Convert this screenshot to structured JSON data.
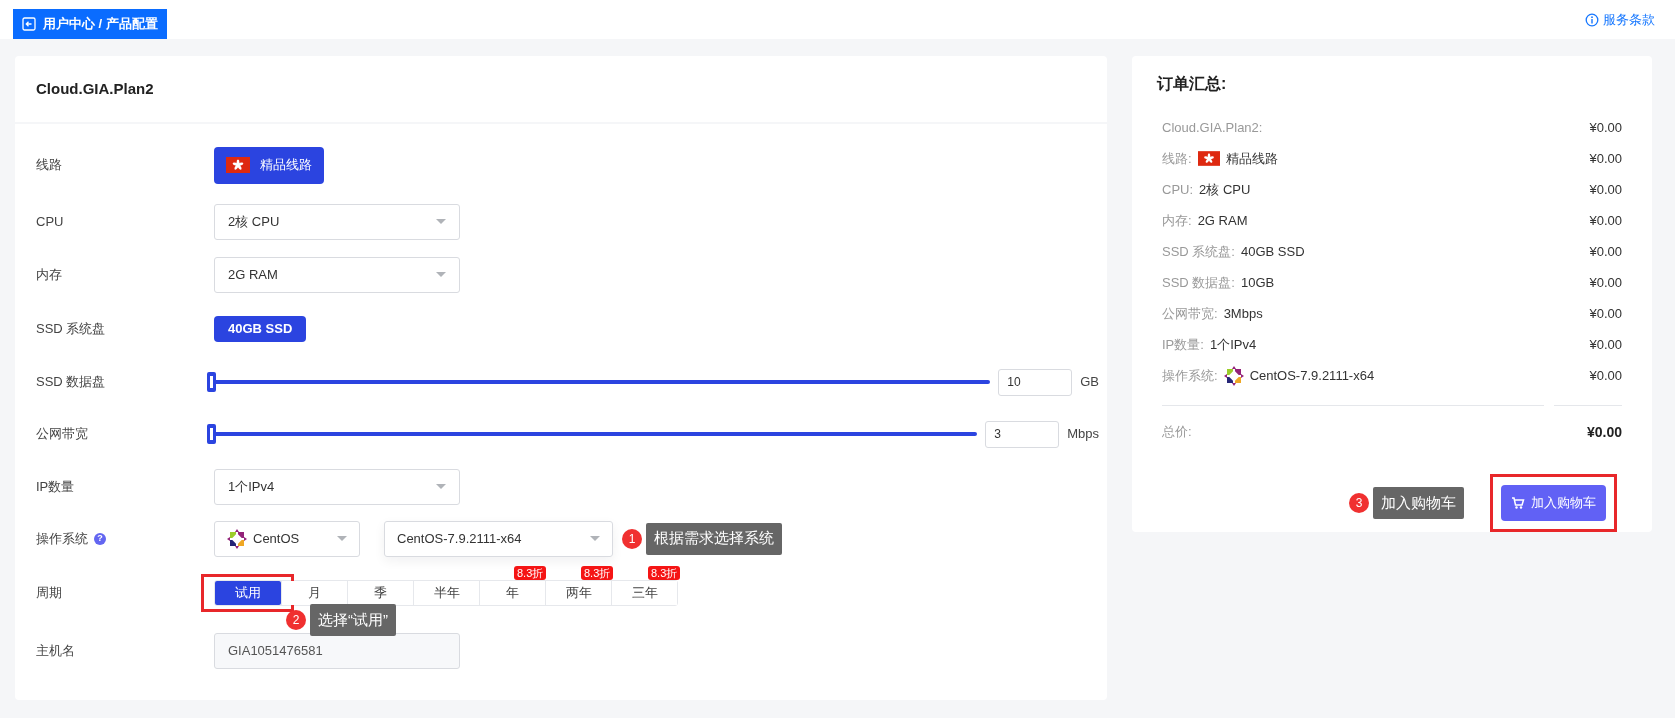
{
  "header": {
    "breadcrumb": "用户中心 / 产品配置",
    "terms_link": "服务条款"
  },
  "config": {
    "title": "Cloud.GIA.Plan2",
    "fields": [
      {
        "kind": "route",
        "label": "线路",
        "value": "精品线路"
      },
      {
        "kind": "select",
        "label": "CPU",
        "value": "2核 CPU"
      },
      {
        "kind": "select",
        "label": "内存",
        "value": "2G RAM"
      },
      {
        "kind": "button",
        "label": "SSD 系统盘",
        "value": "40GB SSD"
      },
      {
        "kind": "slider",
        "label": "SSD 数据盘",
        "level": 0,
        "value": "10",
        "unit": "GB"
      },
      {
        "kind": "slider",
        "label": "公网带宽",
        "level": 0,
        "value": "3",
        "unit": "Mbps"
      },
      {
        "kind": "select",
        "label": "IP数量",
        "value": "1个IPv4"
      },
      {
        "kind": "os",
        "label": "操作系统",
        "help": "?",
        "family": "CentOS",
        "version": "CentOS-7.9.2111-x64",
        "annotation": {
          "number": "1",
          "text": "根据需求选择系统"
        }
      },
      {
        "kind": "period",
        "label": "周期",
        "options": [
          {
            "label": "试用",
            "selected": true,
            "highlighted": true
          },
          {
            "label": "月",
            "selected": false
          },
          {
            "label": "季",
            "selected": false
          },
          {
            "label": "半年",
            "selected": false
          },
          {
            "label": "年",
            "selected": false,
            "discount": "8.3折"
          },
          {
            "label": "两年",
            "selected": false,
            "discount": "8.3折"
          },
          {
            "label": "三年",
            "selected": false,
            "discount": "8.3折"
          }
        ],
        "annotation": {
          "number": "2",
          "text": "选择“试用”"
        }
      },
      {
        "kind": "text",
        "label": "主机名",
        "value": "GIA1051476581"
      }
    ]
  },
  "summary": {
    "title": "订单汇总:",
    "rows": [
      {
        "label": "Cloud.GIA.Plan2:",
        "price": "¥0.00"
      },
      {
        "kind": "route",
        "label": "线路:",
        "value": "精品线路",
        "price": "¥0.00"
      },
      {
        "label": "CPU:",
        "value": "2核 CPU",
        "price": "¥0.00"
      },
      {
        "label": "内存:",
        "value": "2G RAM",
        "price": "¥0.00"
      },
      {
        "label": "SSD 系统盘:",
        "value": "40GB SSD",
        "price": "¥0.00"
      },
      {
        "label": "SSD 数据盘:",
        "value": "10GB",
        "price": "¥0.00"
      },
      {
        "label": "公网带宽:",
        "value": "3Mbps",
        "price": "¥0.00"
      },
      {
        "label": "IP数量:",
        "value": "1个IPv4",
        "price": "¥0.00"
      },
      {
        "kind": "os",
        "label": "操作系统:",
        "value": "CentOS-7.9.2111-x64",
        "price": "¥0.00"
      }
    ],
    "total_label": "总价:",
    "total": "¥0.00",
    "cart_button": {
      "label": "加入购物车",
      "highlighted": true,
      "annotation": {
        "number": "3",
        "text": "加入购物车"
      }
    }
  }
}
